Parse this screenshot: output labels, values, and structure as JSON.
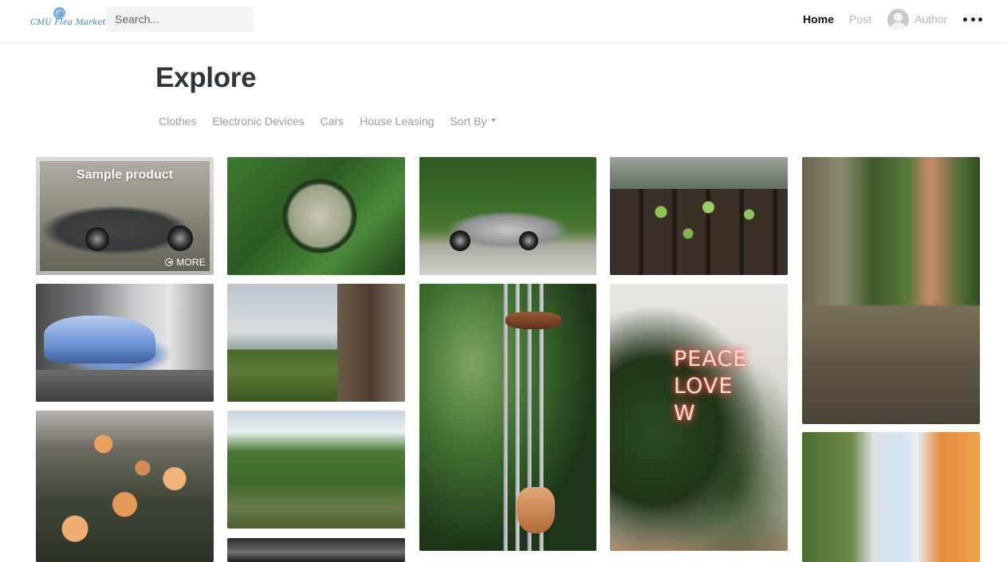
{
  "app": {
    "logo_text": "CMU Flea Market"
  },
  "search": {
    "placeholder": "Search...",
    "value": ""
  },
  "nav": {
    "home_label": "Home",
    "post_label": "Post",
    "author_label": "Author"
  },
  "page": {
    "title": "Explore"
  },
  "filters": {
    "items": [
      "Clothes",
      "Electronic Devices",
      "Cars",
      "House Leasing"
    ],
    "sort_label": "Sort By"
  },
  "featured": {
    "title": "Sample product",
    "more_label": "MORE"
  },
  "neon_sign": {
    "line1": "PEACE",
    "line2": "LOVE",
    "line3": "W"
  },
  "colors": {
    "accent": "#3a7fc2",
    "text_dark": "#2f3439",
    "text_muted": "#9b9b9b"
  }
}
